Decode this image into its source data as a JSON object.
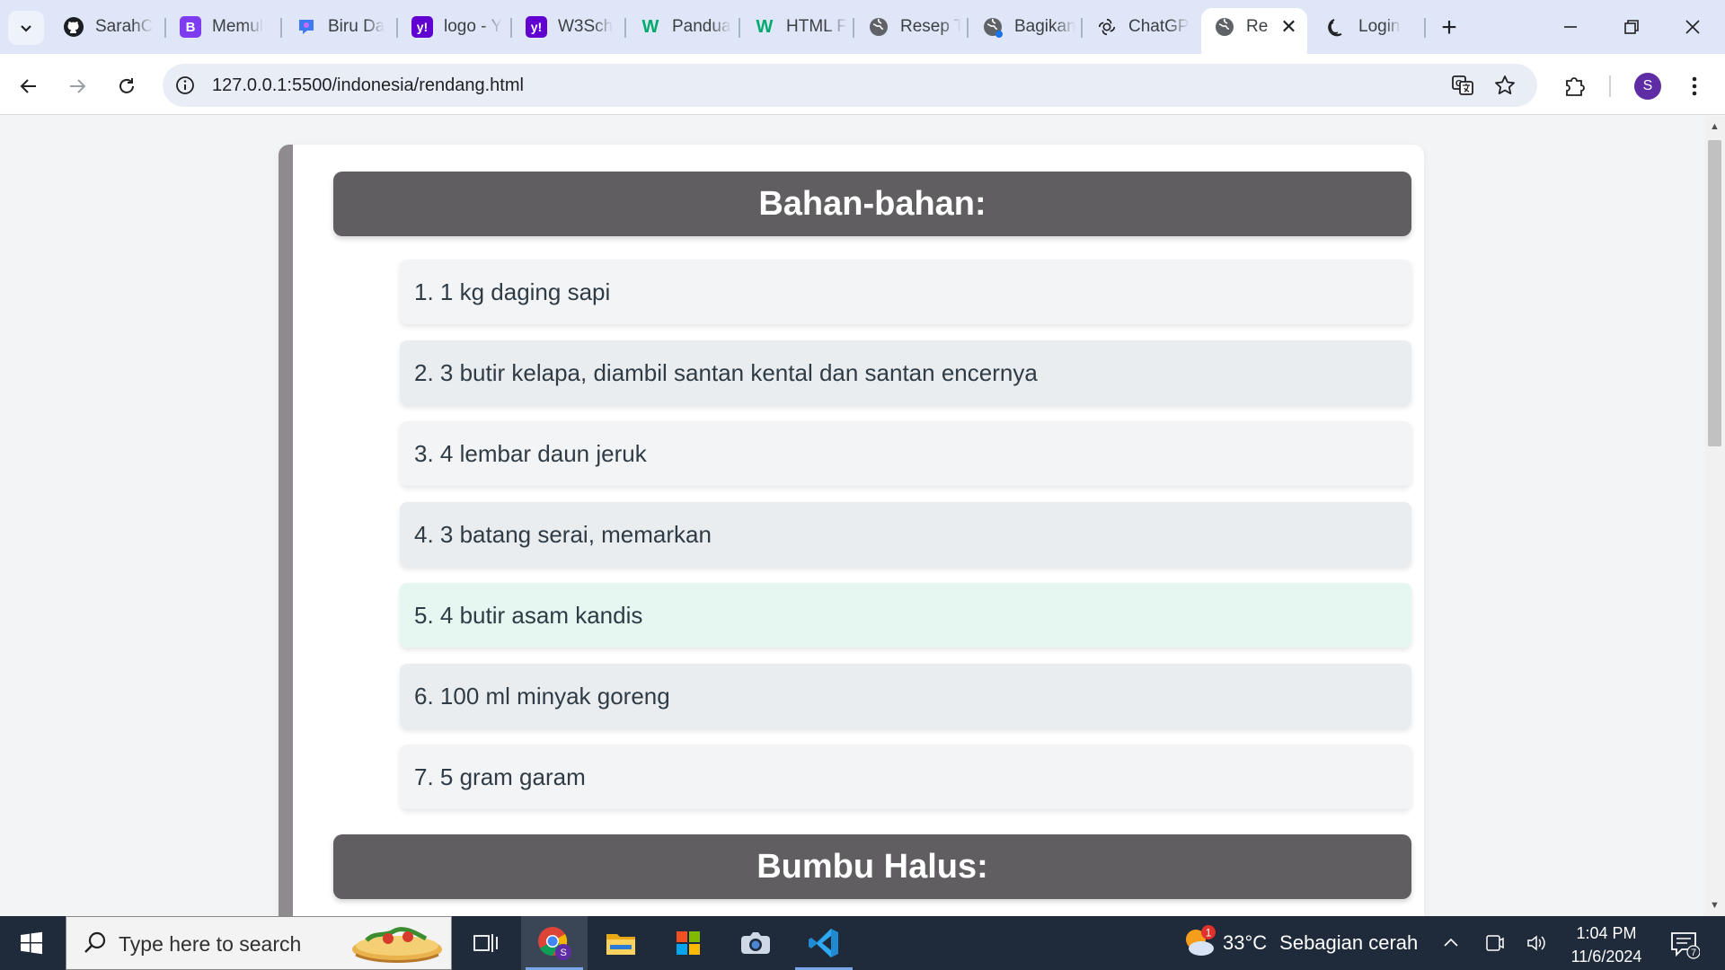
{
  "browser": {
    "tabs": [
      {
        "title": "SarahC",
        "icon": "github-icon"
      },
      {
        "title": "Memul",
        "icon": "bootstrap-icon"
      },
      {
        "title": "Biru Da",
        "icon": "canva-icon"
      },
      {
        "title": "logo - Y",
        "icon": "yahoo-icon"
      },
      {
        "title": "W3Sch",
        "icon": "yahoo-icon"
      },
      {
        "title": "Pandua",
        "icon": "w3-icon"
      },
      {
        "title": "HTML F",
        "icon": "w3-icon"
      },
      {
        "title": "Resep T",
        "icon": "globe-icon"
      },
      {
        "title": "Bagikan",
        "icon": "globe-icon"
      },
      {
        "title": "ChatGP",
        "icon": "chatgpt-icon"
      },
      {
        "title": "Re",
        "icon": "globe-icon",
        "active": true
      },
      {
        "title": "Login",
        "icon": "moon-icon"
      }
    ],
    "url": "127.0.0.1:5500/indonesia/rendang.html",
    "profile_initial": "S"
  },
  "page": {
    "ingredients_heading": "Bahan-bahan:",
    "ingredients": [
      "1. 1 kg daging sapi",
      "2. 3 butir kelapa, diambil santan kental dan santan encernya",
      "3. 4 lembar daun jeruk",
      "4. 3 batang serai, memarkan",
      "5. 4 butir asam kandis",
      "6. 100 ml minyak goreng",
      "7. 5 gram garam"
    ],
    "spices_heading": "Bumbu Halus:"
  },
  "taskbar": {
    "search_placeholder": "Type here to search",
    "weather_badge": "1",
    "temperature": "33°C",
    "weather_condition": "Sebagian cerah",
    "time": "1:04 PM",
    "date": "11/6/2024",
    "notification_count": "7"
  },
  "colors": {
    "section_header": "#605e60",
    "card_border": "#8e8b8e",
    "item_bg": "#f3f4f6",
    "item_alt_bg": "#eaedef",
    "item_hover_bg": "#e6f7f2",
    "taskbar_bg": "#1f2a3a",
    "tabstrip_bg": "#dee6f7"
  }
}
